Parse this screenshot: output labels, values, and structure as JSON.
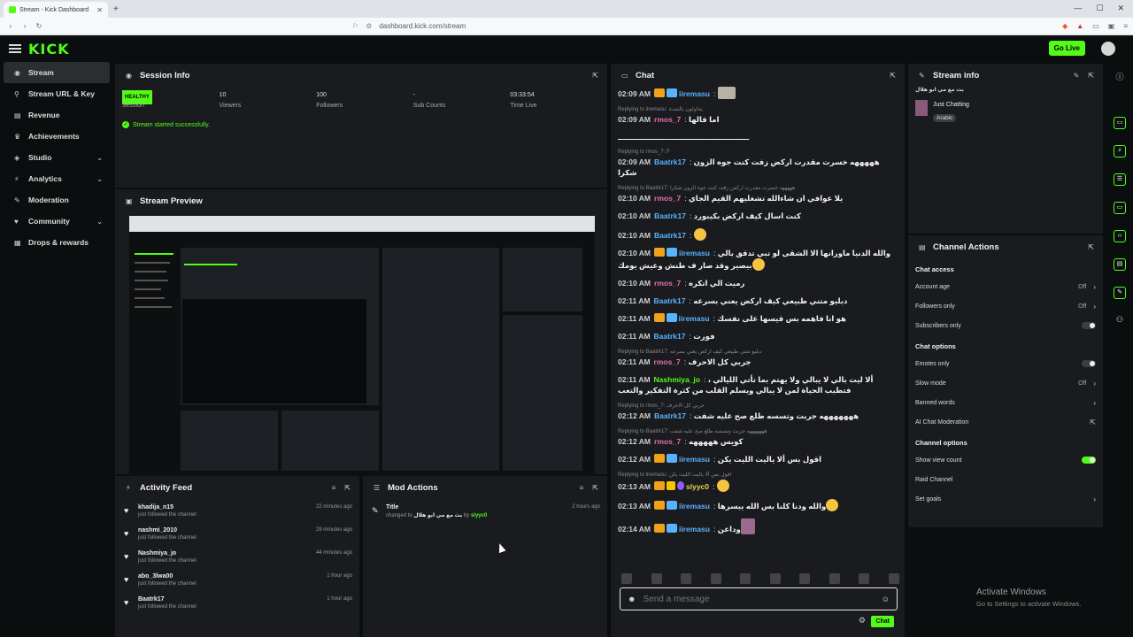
{
  "browser": {
    "tab_title": "Stream - Kick Dashboard",
    "tab_close": "✕",
    "new_tab": "+",
    "url": "dashboard.kick.com/stream"
  },
  "header": {
    "logo": "KICK",
    "go_live": "Go Live"
  },
  "sidebar": {
    "items": [
      {
        "label": "Stream",
        "icon": "broadcast-icon",
        "glyph": "◉",
        "active": true,
        "chevron": false
      },
      {
        "label": "Stream URL & Key",
        "icon": "link-icon",
        "glyph": "⚲",
        "active": false,
        "chevron": false
      },
      {
        "label": "Revenue",
        "icon": "revenue-icon",
        "glyph": "▤",
        "active": false,
        "chevron": false
      },
      {
        "label": "Achievements",
        "icon": "trophy-icon",
        "glyph": "♛",
        "active": false,
        "chevron": false
      },
      {
        "label": "Studio",
        "icon": "studio-icon",
        "glyph": "◈",
        "active": false,
        "chevron": true
      },
      {
        "label": "Analytics",
        "icon": "analytics-icon",
        "glyph": "⚡",
        "active": false,
        "chevron": true
      },
      {
        "label": "Moderation",
        "icon": "hammer-icon",
        "glyph": "✎",
        "active": false,
        "chevron": false
      },
      {
        "label": "Community",
        "icon": "community-icon",
        "glyph": "♥",
        "active": false,
        "chevron": true
      },
      {
        "label": "Drops & rewards",
        "icon": "gift-icon",
        "glyph": "▦",
        "active": false,
        "chevron": false
      }
    ]
  },
  "session": {
    "title": "Session Info",
    "health": "HEALTHY",
    "stats": [
      {
        "value": "",
        "label": "Session"
      },
      {
        "value": "10",
        "label": "Viewers"
      },
      {
        "value": "100",
        "label": "Followers"
      },
      {
        "value": "-",
        "label": "Sub Counts"
      },
      {
        "value": "03:33:54",
        "label": "Time Live"
      }
    ],
    "status": "Stream started successfully."
  },
  "preview": {
    "title": "Stream Preview"
  },
  "activity": {
    "title": "Activity Feed",
    "items": [
      {
        "name": "khadija_n15",
        "sub": "just followed the channel",
        "time": "22 minutes ago"
      },
      {
        "name": "nashmi_2010",
        "sub": "just followed the channel",
        "time": "29 minutes ago"
      },
      {
        "name": "Nashmiya_jo",
        "sub": "just followed the channel",
        "time": "44 minutes ago"
      },
      {
        "name": "abo_3lwa00",
        "sub": "just followed the channel",
        "time": "1 hour ago"
      },
      {
        "name": "Baatrk17",
        "sub": "just followed the channel",
        "time": "1 hour ago"
      }
    ]
  },
  "mod_actions": {
    "title": "Mod Actions",
    "items": [
      {
        "title": "Title",
        "text": "changed to",
        "value": "بث مع مي ابو هلال",
        "by": "by",
        "user": "slyyc0",
        "time": "2 hours ago"
      }
    ]
  },
  "chat": {
    "title": "Chat",
    "placeholder": "Send a message",
    "send": "Chat",
    "messages": [
      {
        "reply": "",
        "time": "02:09 AM",
        "badges": [
          "crown",
          "arrow"
        ],
        "user": "iiremasu",
        "color": "#58b3ff",
        "text": "",
        "emote": "img"
      },
      {
        "reply": "Replying to iiremasu: يحاولون بالشدة",
        "time": "02:09 AM",
        "badges": [],
        "user": "rmos_7",
        "color": "#e46fa8",
        "text": "اما قالها",
        "emote": ""
      },
      {
        "reply": "",
        "time": "",
        "badges": [],
        "user": "",
        "color": "#e46fa8",
        "text": "ـــــــــــــــــــــــــــــــــــــــــــــــــــ",
        "emote": ""
      },
      {
        "reply": "Replying to rmos_7: F",
        "time": "02:09 AM",
        "badges": [],
        "user": "Baatrk17",
        "color": "#58b3ff",
        "text": "هههههه خسرت مقدرت اركض زفت كنت جوه الزون شكرا",
        "emote": ""
      },
      {
        "reply": "Replying to Baatrk17: هههههه خسرت مقدرت اركض زفت كنت جوه الزون شكرا",
        "time": "02:10 AM",
        "badges": [],
        "user": "rmos_7",
        "color": "#e46fa8",
        "text": "يلا عوافي ان شاءالله تشغليهم القيم الجاي",
        "emote": ""
      },
      {
        "reply": "",
        "time": "02:10 AM",
        "badges": [],
        "user": "Baatrk17",
        "color": "#58b3ff",
        "text": "كنت اسال كيف اركض بكيبورد",
        "emote": ""
      },
      {
        "reply": "",
        "time": "02:10 AM",
        "badges": [],
        "user": "Baatrk17",
        "color": "#58b3ff",
        "text": "",
        "emote": "round"
      },
      {
        "reply": "",
        "time": "02:10 AM",
        "badges": [
          "crown",
          "arrow"
        ],
        "user": "iiremasu",
        "color": "#58b3ff",
        "text": "والله الدنيا ماورانها الا الشقى لو تبي تدقق بالي بيصير وقد صار ف طنش وعيش يومك",
        "emote": "round"
      },
      {
        "reply": "",
        "time": "02:10 AM",
        "badges": [],
        "user": "rmos_7",
        "color": "#e46fa8",
        "text": "رميت الي اتكره",
        "emote": ""
      },
      {
        "reply": "",
        "time": "02:11 AM",
        "badges": [],
        "user": "Baatrk17",
        "color": "#58b3ff",
        "text": "دبليو متني طبيعي كيف اركض يعني بسرعه",
        "emote": ""
      },
      {
        "reply": "",
        "time": "02:11 AM",
        "badges": [
          "crown",
          "arrow"
        ],
        "user": "iiremasu",
        "color": "#58b3ff",
        "text": "هو انا فاهمه بس قيسها على نفسك",
        "emote": ""
      },
      {
        "reply": "",
        "time": "02:11 AM",
        "badges": [],
        "user": "Baatrk17",
        "color": "#58b3ff",
        "text": "فورت",
        "emote": ""
      },
      {
        "reply": "Replying to Baatrk17: دبليو متني طبيعي كيف اركض يعني بسرعه",
        "time": "02:11 AM",
        "badges": [],
        "user": "rmos_7",
        "color": "#e46fa8",
        "text": "جربي كل الاحرف",
        "emote": ""
      },
      {
        "reply": "",
        "time": "02:11 AM",
        "badges": [],
        "user": "Nashmiya_jo",
        "color": "#53fc18",
        "text": "ألا ليت بالي لا يبالي ولا يهتم بما تأتي الليالي ، فتطيب الحياة لمن لا يبالي ويسلم القلب من كثرة التفكير والتعب",
        "emote": ""
      },
      {
        "reply": "Replying to rmos_7: جربي كل الاحرف",
        "time": "02:12 AM",
        "badges": [],
        "user": "Baatrk17",
        "color": "#58b3ff",
        "text": "هههههههه جربت وتسسه طلع صح عليه شفت",
        "emote": ""
      },
      {
        "reply": "Replying to Baatrk17: هههههههه جربت وتسسه طلع صح عليه شفت",
        "time": "02:12 AM",
        "badges": [],
        "user": "rmos_7",
        "color": "#e46fa8",
        "text": "كويس هههههه",
        "emote": ""
      },
      {
        "reply": "",
        "time": "02:12 AM",
        "badges": [
          "crown",
          "arrow"
        ],
        "user": "iiremasu",
        "color": "#58b3ff",
        "text": "اقول بس ألا ياليت الليت يكن",
        "emote": ""
      },
      {
        "reply": "Replying to iiremasu: اقول بس ألا ياليت الليت يكن",
        "time": "02:13 AM",
        "badges": [
          "crown",
          "16",
          "purple"
        ],
        "user": "slyyc0",
        "color": "#e6d64a",
        "text": "",
        "emote": "round"
      },
      {
        "reply": "",
        "time": "02:13 AM",
        "badges": [
          "crown",
          "arrow"
        ],
        "user": "iiremasu",
        "color": "#58b3ff",
        "text": "والله ودنا كلنا بس الله ييسرها",
        "emote": "round"
      },
      {
        "reply": "",
        "time": "02:14 AM",
        "badges": [
          "crown",
          "arrow"
        ],
        "user": "iiremasu",
        "color": "#58b3ff",
        "text": "وداعن",
        "emote": "sq"
      }
    ]
  },
  "stream_info": {
    "title": "Stream info",
    "stream_title": "بث مع مي ابو هلال",
    "category": "Just Chatting",
    "tag": "Arabic"
  },
  "channel_actions": {
    "title": "Channel Actions",
    "sections": [
      {
        "title": "Chat access",
        "rows": [
          {
            "label": "Account age",
            "value": "Off",
            "kind": "arrow"
          },
          {
            "label": "Followers only",
            "value": "Off",
            "kind": "arrow"
          },
          {
            "label": "Subscribers only",
            "value": "",
            "kind": "toggle-off"
          }
        ]
      },
      {
        "title": "Chat options",
        "rows": [
          {
            "label": "Emotes only",
            "value": "",
            "kind": "toggle-off"
          },
          {
            "label": "Slow mode",
            "value": "Off",
            "kind": "arrow"
          },
          {
            "label": "Banned words",
            "value": "",
            "kind": "arrow"
          },
          {
            "label": "AI Chat Moderation",
            "value": "",
            "kind": "external"
          }
        ]
      },
      {
        "title": "Channel options",
        "rows": [
          {
            "label": "Show view count",
            "value": "",
            "kind": "toggle-on"
          },
          {
            "label": "Raid Channel",
            "value": "",
            "kind": "none"
          },
          {
            "label": "Set goals",
            "value": "",
            "kind": "arrow"
          }
        ]
      }
    ]
  },
  "windows_notice": {
    "line1": "Activate Windows",
    "line2": "Go to Settings to activate Windows."
  }
}
